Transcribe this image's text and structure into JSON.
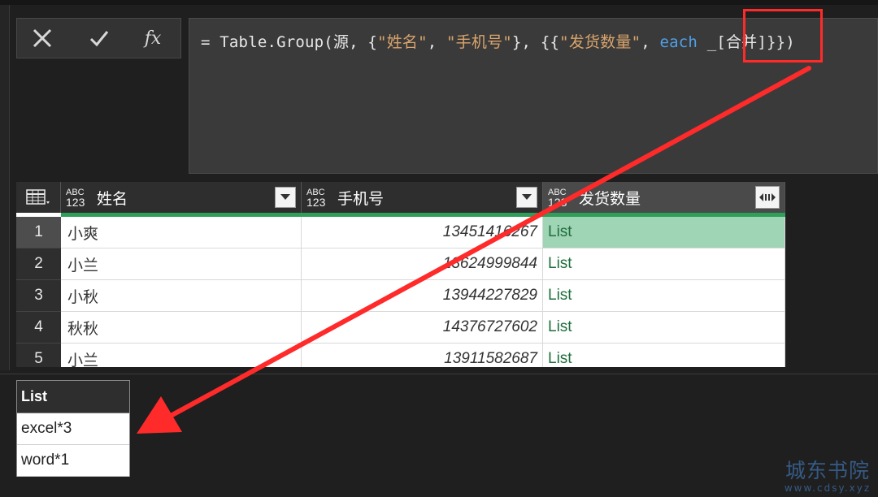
{
  "formula_bar": {
    "cancel_icon": "close-icon",
    "confirm_icon": "check-icon",
    "fx_label": "fx",
    "formula": {
      "prefix": "= Table.Group(源, {",
      "str1": "\"姓名\"",
      "comma1": ", ",
      "str2": "\"手机号\"",
      "mid": "}, {{",
      "str3": "\"发货数量\"",
      "comma2": ", ",
      "keyword": "each",
      "suffix": " _[合并]}})"
    }
  },
  "table": {
    "corner_icon": "table-menu-icon",
    "type_top": "ABC",
    "type_bottom": "123",
    "columns": [
      {
        "name": "姓名"
      },
      {
        "name": "手机号"
      },
      {
        "name": "发货数量"
      }
    ],
    "rows": [
      {
        "num": "1",
        "name": "小爽",
        "phone": "13451416267",
        "value": "List"
      },
      {
        "num": "2",
        "name": "小兰",
        "phone": "13624999844",
        "value": "List"
      },
      {
        "num": "3",
        "name": "小秋",
        "phone": "13944227829",
        "value": "List"
      },
      {
        "num": "4",
        "name": "秋秋",
        "phone": "14376727602",
        "value": "List"
      },
      {
        "num": "5",
        "name": "小兰",
        "phone": "13911582687",
        "value": "List"
      }
    ]
  },
  "list_preview": {
    "header": "List",
    "items": [
      "excel*3",
      "word*1"
    ]
  },
  "watermark": {
    "main": "城东书院",
    "sub": "www.cdsy.xyz"
  },
  "colors": {
    "accent_green": "#2f9e5a",
    "annotation_red": "#ff2a2a",
    "keyword_blue": "#4fa0e8",
    "string_orange": "#d9a46c"
  }
}
